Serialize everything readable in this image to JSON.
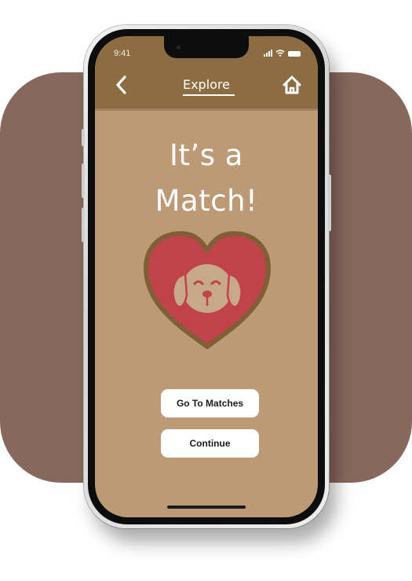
{
  "status_bar": {
    "time": "9:41"
  },
  "header": {
    "title": "Explore",
    "back_icon": "chevron-left",
    "home_icon": "house"
  },
  "main": {
    "title_line1": "It’s a",
    "title_line2": "Match!",
    "illustration": "heart-with-dog-face"
  },
  "actions": {
    "go_to_matches_label": "Go To Matches",
    "continue_label": "Continue"
  },
  "colors": {
    "backdrop": "#87685d",
    "screen_background": "#bb9a75",
    "header_background": "#8c6d43",
    "heart_fill": "#c0434a",
    "heart_outline": "#7e5f36",
    "dog_face": "#c7a98a",
    "button_background": "#ffffff"
  }
}
